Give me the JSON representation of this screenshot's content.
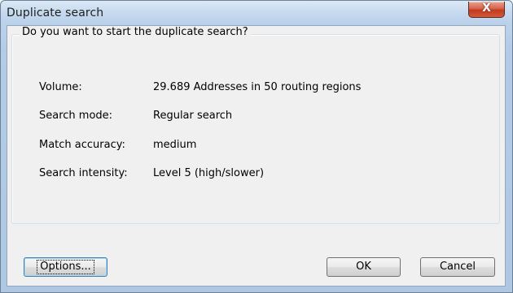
{
  "window": {
    "title": "Duplicate search",
    "close_symbol": "X"
  },
  "group": {
    "title": "Do you want to start the duplicate search?"
  },
  "rows": [
    {
      "label": "Volume:",
      "value": "29.689 Addresses in 50 routing regions"
    },
    {
      "label": "Search mode:",
      "value": "Regular search"
    },
    {
      "label": "Match accuracy:",
      "value": "medium"
    },
    {
      "label": "Search intensity:",
      "value": "Level 5 (high/slower)"
    }
  ],
  "buttons": {
    "options": "Options...",
    "ok": "OK",
    "cancel": "Cancel"
  },
  "colors": {
    "frame": "#b3cbe6",
    "close_button": "#c9442a",
    "client_background": "#f0f0f0"
  }
}
